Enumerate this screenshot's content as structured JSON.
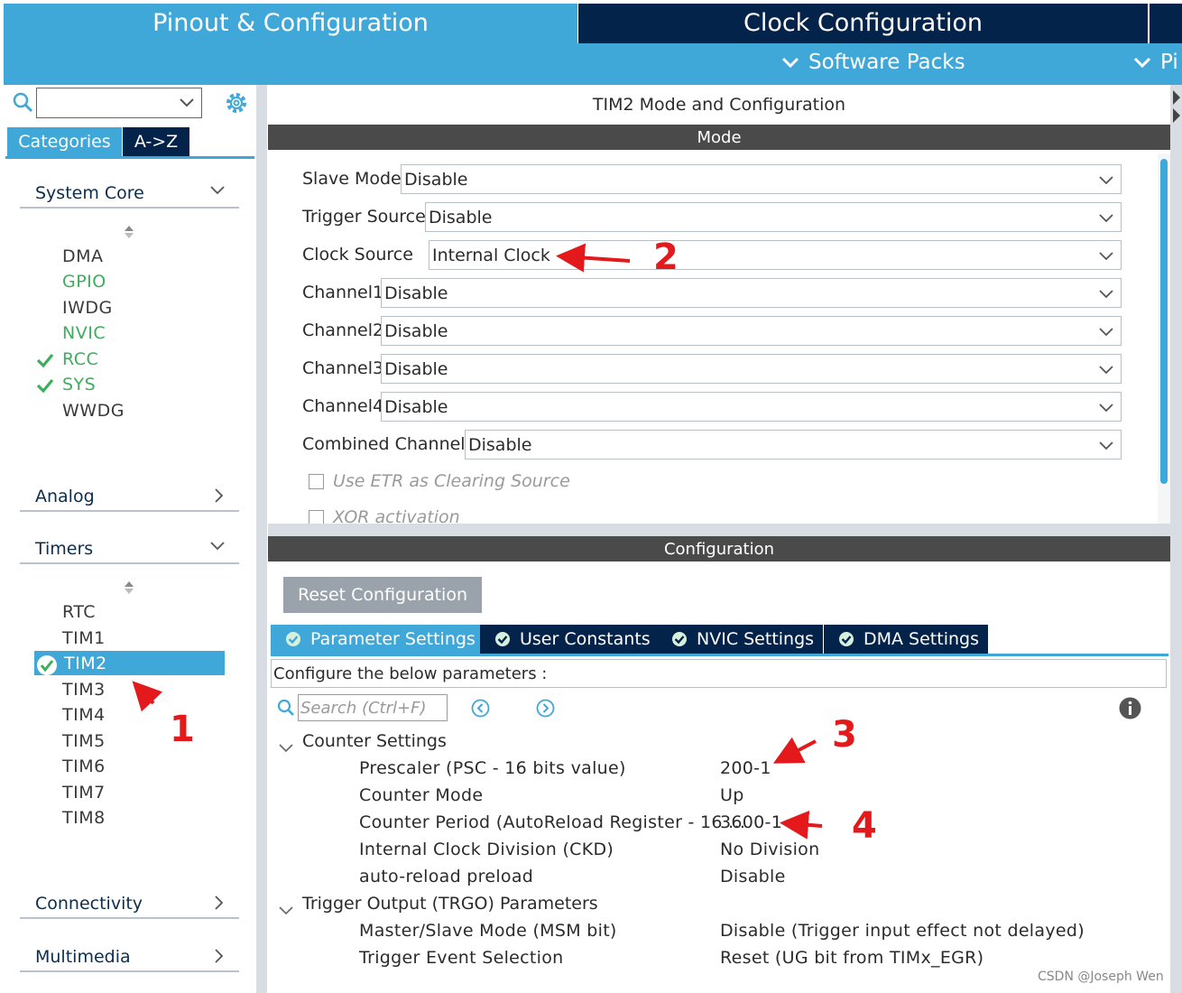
{
  "top_tabs": {
    "pinout": "Pinout & Configuration",
    "clock": "Clock Configuration"
  },
  "sub_bar": {
    "software_packs": "Software Packs",
    "pi": "Pi"
  },
  "left": {
    "search_value": "",
    "tabs": {
      "categories": "Categories",
      "az": "A->Z"
    },
    "groups": {
      "system_core": "System Core",
      "analog": "Analog",
      "timers": "Timers",
      "connectivity": "Connectivity",
      "multimedia": "Multimedia"
    },
    "system_core_items": [
      {
        "label": "DMA",
        "color": "default",
        "checked": false
      },
      {
        "label": "GPIO",
        "color": "green",
        "checked": false
      },
      {
        "label": "IWDG",
        "color": "default",
        "checked": false
      },
      {
        "label": "NVIC",
        "color": "green",
        "checked": false
      },
      {
        "label": "RCC",
        "color": "green",
        "checked": true
      },
      {
        "label": "SYS",
        "color": "green",
        "checked": true
      },
      {
        "label": "WWDG",
        "color": "default",
        "checked": false
      }
    ],
    "timer_items": [
      "RTC",
      "TIM1",
      "TIM2",
      "TIM3",
      "TIM4",
      "TIM5",
      "TIM6",
      "TIM7",
      "TIM8"
    ],
    "selected_timer": "TIM2"
  },
  "mode": {
    "title": "TIM2 Mode and Configuration",
    "header": "Mode",
    "fields": [
      {
        "label": "Slave Mode",
        "value": "Disable"
      },
      {
        "label": "Trigger Source",
        "value": "Disable"
      },
      {
        "label": "Clock Source",
        "value": "Internal Clock"
      },
      {
        "label": "Channel1",
        "value": "Disable"
      },
      {
        "label": "Channel2",
        "value": "Disable"
      },
      {
        "label": "Channel3",
        "value": "Disable"
      },
      {
        "label": "Channel4",
        "value": "Disable"
      },
      {
        "label": "Combined Channels",
        "value": "Disable"
      }
    ],
    "checkboxes": {
      "etr": "Use ETR as Clearing Source",
      "xor": "XOR activation"
    }
  },
  "config": {
    "header": "Configuration",
    "reset_label": "Reset Configuration",
    "tabs": [
      "Parameter Settings",
      "User Constants",
      "NVIC Settings",
      "DMA Settings"
    ],
    "description": "Configure the below parameters :",
    "search_placeholder": "Search (Ctrl+F)",
    "sections": {
      "counter": "Counter Settings",
      "trgo": "Trigger Output (TRGO) Parameters"
    },
    "counter_rows": [
      {
        "key": "Prescaler (PSC - 16 bits value)",
        "value": "200-1"
      },
      {
        "key": "Counter Mode",
        "value": "Up"
      },
      {
        "key": "Counter Period (AutoReload Register - 16 ...",
        "value": "3600-1"
      },
      {
        "key": "Internal Clock Division (CKD)",
        "value": "No Division"
      },
      {
        "key": "auto-reload preload",
        "value": "Disable"
      }
    ],
    "trgo_rows": [
      {
        "key": "Master/Slave Mode (MSM bit)",
        "value": "Disable (Trigger input effect not delayed)"
      },
      {
        "key": "Trigger Event Selection",
        "value": "Reset (UG bit from TIMx_EGR)"
      }
    ]
  },
  "annotations": {
    "a1": "1",
    "a2": "2",
    "a3": "3",
    "a4": "4"
  },
  "watermark": "CSDN @Joseph Wen",
  "colors": {
    "accent": "#3fa8d8",
    "navy": "#03234b",
    "green": "#3dae5c",
    "annotation": "#e3191c"
  }
}
